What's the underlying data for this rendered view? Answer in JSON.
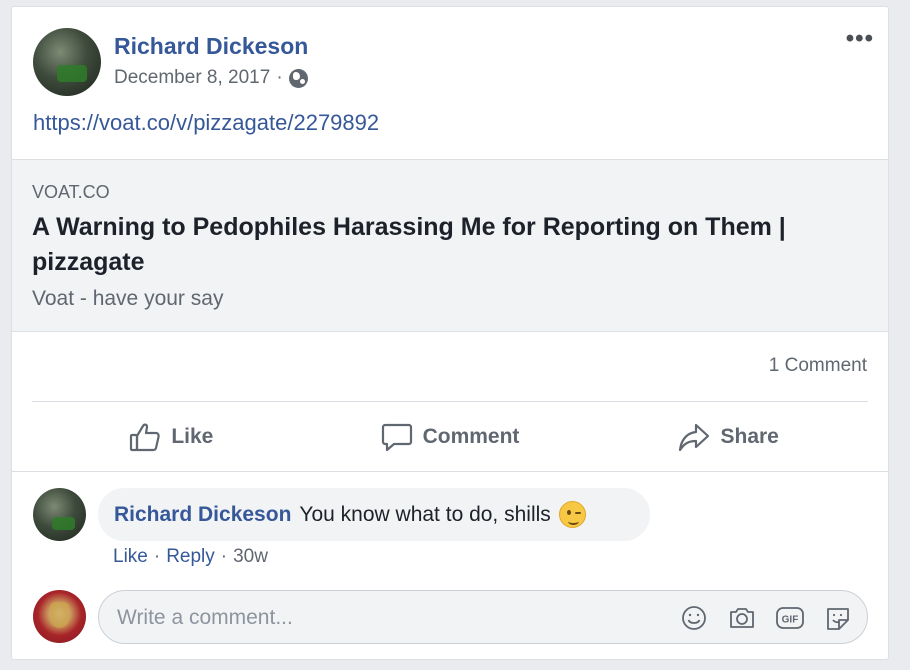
{
  "post": {
    "author": "Richard Dickeson",
    "date": "December 8, 2017",
    "separator": "·",
    "privacy_icon": "globe-icon",
    "more_icon": "more-options-icon",
    "more_label": "•••",
    "link_url": "https://voat.co/v/pizzagate/2279892"
  },
  "preview": {
    "domain": "VOAT.CO",
    "title": "A Warning to Pedophiles Harassing Me for Reporting on Them | pizzagate",
    "description": "Voat - have your say"
  },
  "stats": {
    "comment_count": "1 Comment"
  },
  "actions": [
    {
      "label": "Like",
      "icon": "thumbs-up-icon"
    },
    {
      "label": "Comment",
      "icon": "comment-bubble-icon"
    },
    {
      "label": "Share",
      "icon": "share-arrow-icon"
    }
  ],
  "comment": {
    "author": "Richard Dickeson",
    "text": "You know what to do, shills",
    "emoji_icon": "winking-face-icon",
    "like": "Like",
    "reply": "Reply",
    "dot": "·",
    "time": "30w"
  },
  "composer": {
    "placeholder": "Write a comment...",
    "icons": [
      "emoji-icon",
      "camera-icon",
      "gif-icon",
      "sticker-icon"
    ]
  },
  "colors": {
    "link": "#365899",
    "muted": "#606770",
    "preview_bg": "#f2f3f5",
    "page_bg": "#e9ebee"
  }
}
